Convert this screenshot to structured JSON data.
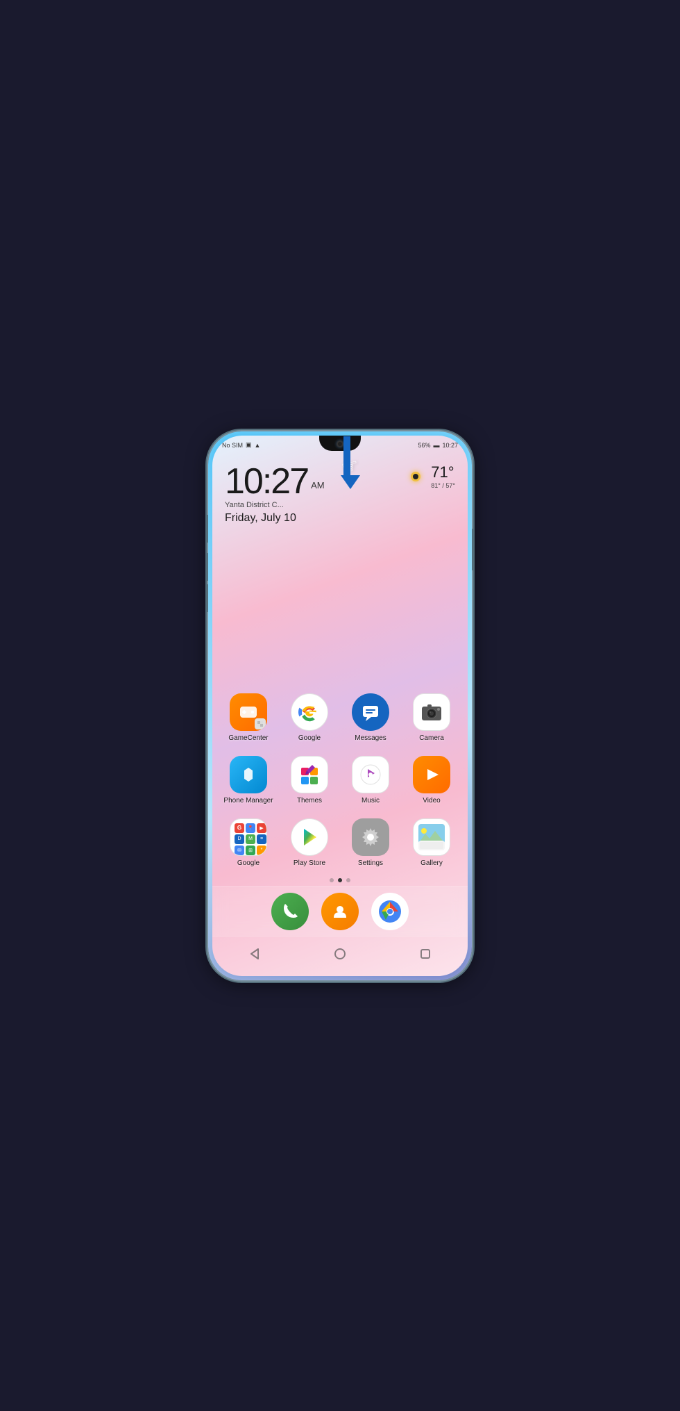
{
  "status_bar": {
    "left": "No SIM",
    "battery": "56%",
    "time": "10:27"
  },
  "clock": {
    "time": "10:27",
    "ampm": "AM",
    "location": "Yanta District C...",
    "date": "Friday, July 10",
    "weather_temp": "71°",
    "weather_range": "81° / 57°"
  },
  "apps": {
    "row1": [
      {
        "id": "game-center",
        "label": "GameCenter",
        "icon_type": "gamecenter"
      },
      {
        "id": "google",
        "label": "Google",
        "icon_type": "google-search"
      },
      {
        "id": "messages",
        "label": "Messages",
        "icon_type": "messages"
      },
      {
        "id": "camera",
        "label": "Camera",
        "icon_type": "camera"
      }
    ],
    "row2": [
      {
        "id": "phone-manager",
        "label": "Phone Manager",
        "icon_type": "phone-manager"
      },
      {
        "id": "themes",
        "label": "Themes",
        "icon_type": "themes"
      },
      {
        "id": "music",
        "label": "Music",
        "icon_type": "music"
      },
      {
        "id": "video",
        "label": "Video",
        "icon_type": "video"
      }
    ],
    "row3": [
      {
        "id": "google-folder",
        "label": "Google",
        "icon_type": "google-folder"
      },
      {
        "id": "play-store",
        "label": "Play Store",
        "icon_type": "play-store"
      },
      {
        "id": "settings",
        "label": "Settings",
        "icon_type": "settings"
      },
      {
        "id": "gallery",
        "label": "Gallery",
        "icon_type": "gallery"
      }
    ]
  },
  "dock": [
    {
      "id": "phone",
      "icon_type": "phone"
    },
    {
      "id": "contacts",
      "icon_type": "contacts"
    },
    {
      "id": "chrome",
      "icon_type": "chrome"
    }
  ],
  "nav": {
    "back": "◁",
    "home": "○",
    "recent": "□"
  }
}
